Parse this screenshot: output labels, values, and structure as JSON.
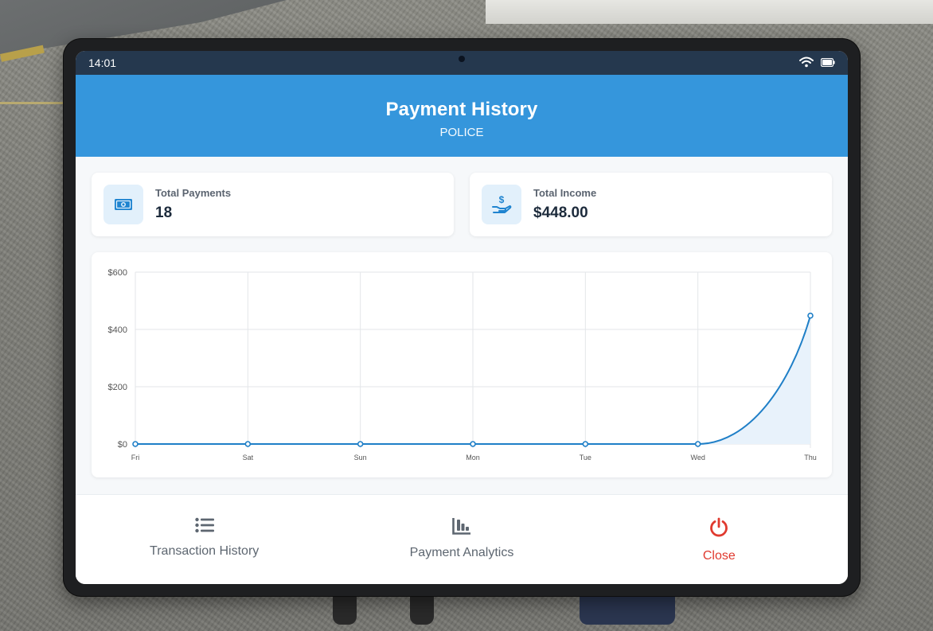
{
  "statusbar": {
    "time": "14:01",
    "icons": [
      "wifi-icon",
      "battery-icon"
    ]
  },
  "header": {
    "title": "Payment History",
    "subtitle": "POLICE",
    "color": "#3596dc"
  },
  "stats": [
    {
      "label": "Total Payments",
      "value": "18",
      "icon": "money-bill-icon"
    },
    {
      "label": "Total Income",
      "value": "$448.00",
      "icon": "hand-dollar-icon"
    }
  ],
  "chart_data": {
    "type": "area",
    "categories": [
      "Fri",
      "Sat",
      "Sun",
      "Mon",
      "Tue",
      "Wed",
      "Thu"
    ],
    "values": [
      0,
      0,
      0,
      0,
      0,
      0,
      448
    ],
    "yticks": [
      "$0",
      "$200",
      "$400",
      "$600"
    ],
    "ylim": [
      0,
      600
    ],
    "grid": true,
    "line_color": "#1f7fc7",
    "fill_color": "#e8f2fb"
  },
  "footer": {
    "items": [
      {
        "label": "Transaction History",
        "icon": "list-icon"
      },
      {
        "label": "Payment Analytics",
        "icon": "chart-bar-icon"
      },
      {
        "label": "Close",
        "icon": "power-icon",
        "color": "#e03a2f"
      }
    ]
  }
}
